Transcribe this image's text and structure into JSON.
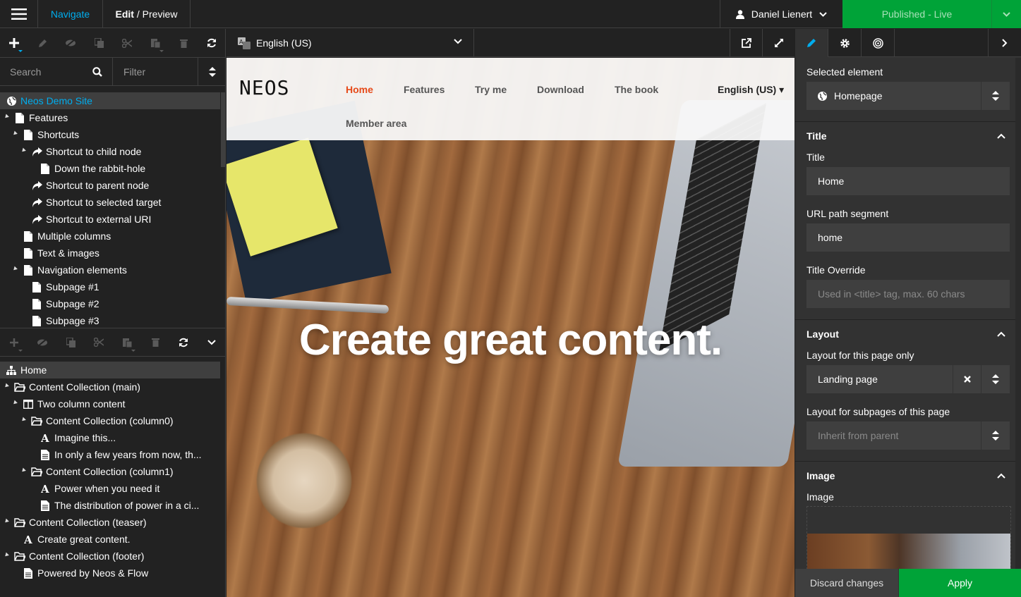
{
  "topbar": {
    "navigate": "Navigate",
    "edit": "Edit",
    "preview": " / Preview",
    "user": "Daniel Lienert",
    "publish": "Published - Live"
  },
  "left": {
    "search_placeholder": "Search",
    "filter_placeholder": "Filter",
    "page_tree": [
      {
        "label": "Neos Demo Site",
        "icon": "globe-icon",
        "depth": 0
      },
      {
        "label": "Features",
        "icon": "page-icon",
        "depth": 1
      },
      {
        "label": "Shortcuts",
        "icon": "page-icon",
        "depth": 2
      },
      {
        "label": "Shortcut to child node",
        "icon": "shortcut-icon",
        "depth": 3
      },
      {
        "label": "Down the rabbit-hole",
        "icon": "page-icon",
        "depth": 4
      },
      {
        "label": "Shortcut to parent node",
        "icon": "shortcut-icon",
        "depth": 3
      },
      {
        "label": "Shortcut to selected target",
        "icon": "shortcut-icon",
        "depth": 3
      },
      {
        "label": "Shortcut to external URI",
        "icon": "shortcut-icon",
        "depth": 3
      },
      {
        "label": "Multiple columns",
        "icon": "page-icon",
        "depth": 2
      },
      {
        "label": "Text & images",
        "icon": "page-icon",
        "depth": 2
      },
      {
        "label": "Navigation elements",
        "icon": "page-icon",
        "depth": 2
      },
      {
        "label": "Subpage #1",
        "icon": "page-icon",
        "depth": 3
      },
      {
        "label": "Subpage #2",
        "icon": "page-icon",
        "depth": 3
      },
      {
        "label": "Subpage #3",
        "icon": "page-icon",
        "depth": 3
      }
    ],
    "content_tree": [
      {
        "label": "Home",
        "icon": "sitemap-icon",
        "depth": 0
      },
      {
        "label": "Content Collection (main)",
        "icon": "folder-icon",
        "depth": 1
      },
      {
        "label": "Two column content",
        "icon": "columns-icon",
        "depth": 2
      },
      {
        "label": "Content Collection (column0)",
        "icon": "folder-icon",
        "depth": 3
      },
      {
        "label": "Imagine this...",
        "icon": "headline-icon",
        "depth": 4
      },
      {
        "label": "In only a few years from now, th...",
        "icon": "text-icon",
        "depth": 4
      },
      {
        "label": "Content Collection (column1)",
        "icon": "folder-icon",
        "depth": 3
      },
      {
        "label": "Power when you need it",
        "icon": "headline-icon",
        "depth": 4
      },
      {
        "label": "The distribution of power in a ci...",
        "icon": "text-icon",
        "depth": 4
      },
      {
        "label": "Content Collection (teaser)",
        "icon": "folder-icon",
        "depth": 1
      },
      {
        "label": "Create great content.",
        "icon": "headline-icon",
        "depth": 2
      },
      {
        "label": "Content Collection (footer)",
        "icon": "folder-icon",
        "depth": 1
      },
      {
        "label": "Powered by Neos & Flow",
        "icon": "text-icon",
        "depth": 2
      }
    ]
  },
  "middle": {
    "language": "English (US)",
    "site": {
      "logo": "NEOS",
      "nav": [
        "Home",
        "Features",
        "Try me",
        "Download",
        "The book"
      ],
      "nav2": "Member area",
      "lang": "English (US) ▾",
      "headline": "Create great content."
    }
  },
  "inspector": {
    "selected_label": "Selected element",
    "selected_value": "Homepage",
    "title_section": "Title",
    "title_label": "Title",
    "title_value": "Home",
    "url_label": "URL path segment",
    "url_value": "home",
    "override_label": "Title Override",
    "override_placeholder": "Used in <title> tag, max. 60 chars",
    "layout_section": "Layout",
    "layout_label": "Layout for this page only",
    "layout_value": "Landing page",
    "sublayout_label": "Layout for subpages of this page",
    "sublayout_value": "Inherit from parent",
    "image_section": "Image",
    "image_label": "Image",
    "discard": "Discard changes",
    "apply": "Apply"
  },
  "colors": {
    "accent": "#00adee",
    "publish_green": "#00a338",
    "site_active": "#e64a19"
  }
}
